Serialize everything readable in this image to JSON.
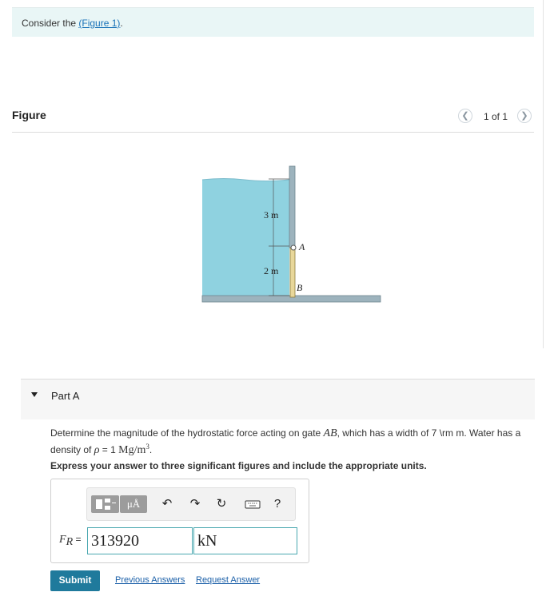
{
  "intro": {
    "prefix": "Consider the ",
    "link_text": "(Figure 1)",
    "suffix": "."
  },
  "figure": {
    "title": "Figure",
    "pager": {
      "count": "1 of 1",
      "prev_icon": "chevron-left-icon",
      "next_icon": "chevron-right-icon"
    },
    "diagram": {
      "label_3m": "3 m",
      "label_2m": "2 m",
      "label_A": "A",
      "label_B": "B",
      "water_color": "#8fd2e0",
      "wall_color": "#9db3bd"
    }
  },
  "part": {
    "label": "Part A",
    "question_before_AB": "Determine the magnitude of the hydrostatic force acting on gate ",
    "AB": "AB",
    "question_after_AB": ", which has a width of 7 \\rm m. Water has a",
    "question_line2_before": "density of ",
    "rho": "ρ",
    "equals": " = 1 ",
    "density_unit": "Mg/m",
    "density_exp": "3",
    "period": ".",
    "instruction": "Express your answer to three significant figures and include the appropriate units."
  },
  "answer": {
    "label_var": "F",
    "label_sub": "R",
    "label_eq": " =",
    "value": "313920",
    "unit": "kN",
    "toolbar": {
      "units_label": "μÅ",
      "help_label": "?",
      "icons": [
        "templates-icon",
        "units-icon",
        "undo-icon",
        "redo-icon",
        "reset-icon",
        "keyboard-icon",
        "help-icon"
      ]
    }
  },
  "actions": {
    "submit": "Submit",
    "previous_answers": "Previous Answers",
    "request_answer": "Request Answer"
  },
  "colors": {
    "accent": "#1f7a9c",
    "link": "#1a73b8",
    "intro_bg": "#e9f6f6",
    "input_border": "#4aa8b0"
  }
}
